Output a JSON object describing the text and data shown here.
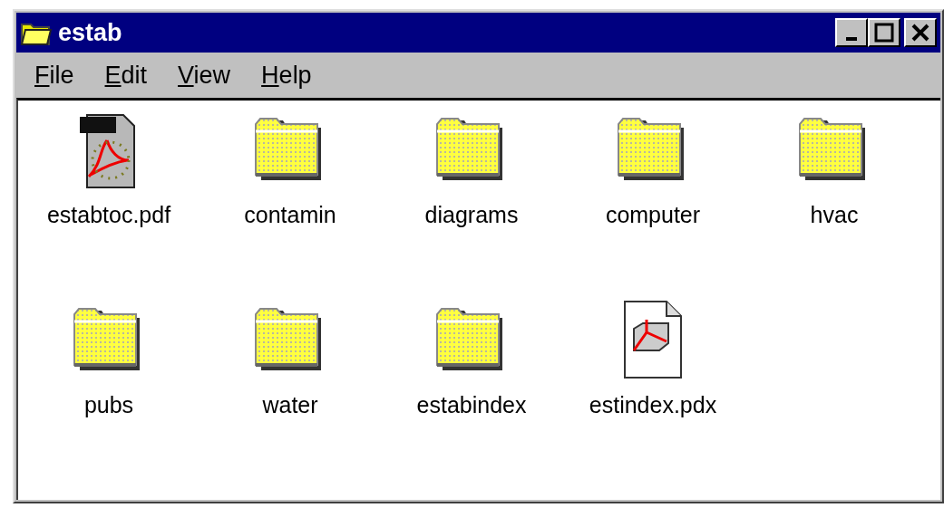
{
  "window": {
    "title": "estab"
  },
  "menu": [
    "File",
    "Edit",
    "View",
    "Help"
  ],
  "items": [
    {
      "name": "estabtoc.pdf",
      "kind": "pdf"
    },
    {
      "name": "contamin",
      "kind": "folder"
    },
    {
      "name": "diagrams",
      "kind": "folder"
    },
    {
      "name": "computer",
      "kind": "folder"
    },
    {
      "name": "hvac",
      "kind": "folder"
    },
    {
      "name": "pubs",
      "kind": "folder"
    },
    {
      "name": "water",
      "kind": "folder"
    },
    {
      "name": "estabindex",
      "kind": "folder"
    },
    {
      "name": "estindex.pdx",
      "kind": "pdx"
    }
  ]
}
